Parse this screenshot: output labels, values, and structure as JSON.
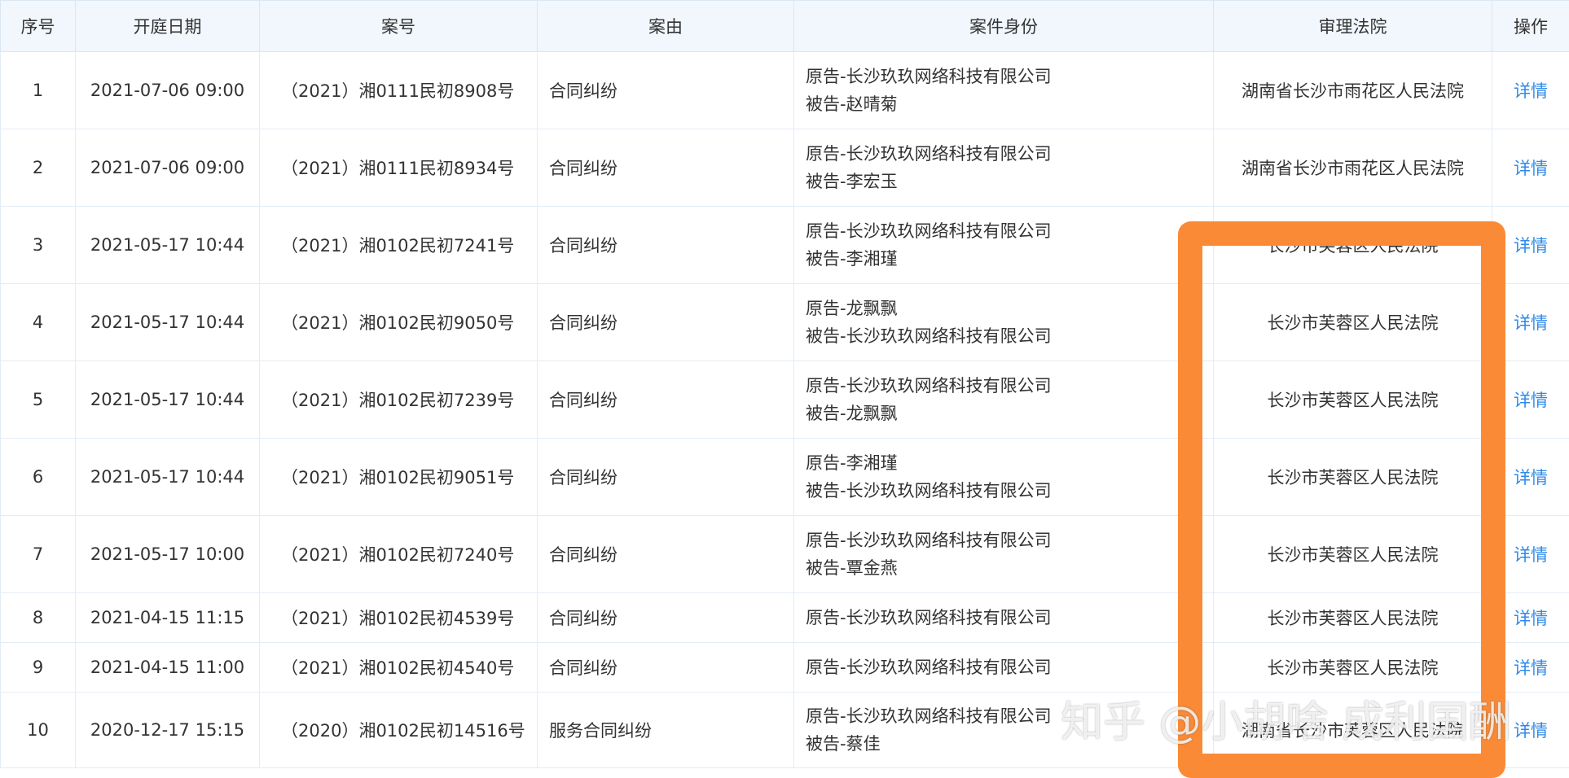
{
  "table": {
    "headers": {
      "no": "序号",
      "date": "开庭日期",
      "case_no": "案号",
      "reason": "案由",
      "identity": "案件身份",
      "court": "审理法院",
      "action": "操作"
    },
    "rows": [
      {
        "no": "1",
        "date": "2021-07-06 09:00",
        "case_no": "（2021）湘0111民初8908号",
        "reason": "合同纠纷",
        "party1": "原告-长沙玖玖网络科技有限公司",
        "party2": "被告-赵晴菊",
        "court": "湖南省长沙市雨花区人民法院",
        "action": "详情"
      },
      {
        "no": "2",
        "date": "2021-07-06 09:00",
        "case_no": "（2021）湘0111民初8934号",
        "reason": "合同纠纷",
        "party1": "原告-长沙玖玖网络科技有限公司",
        "party2": "被告-李宏玉",
        "court": "湖南省长沙市雨花区人民法院",
        "action": "详情"
      },
      {
        "no": "3",
        "date": "2021-05-17 10:44",
        "case_no": "（2021）湘0102民初7241号",
        "reason": "合同纠纷",
        "party1": "原告-长沙玖玖网络科技有限公司",
        "party2": "被告-李湘瑾",
        "court": "长沙市芙蓉区人民法院",
        "action": "详情"
      },
      {
        "no": "4",
        "date": "2021-05-17 10:44",
        "case_no": "（2021）湘0102民初9050号",
        "reason": "合同纠纷",
        "party1": "原告-龙飘飘",
        "party2": "被告-长沙玖玖网络科技有限公司",
        "court": "长沙市芙蓉区人民法院",
        "action": "详情"
      },
      {
        "no": "5",
        "date": "2021-05-17 10:44",
        "case_no": "（2021）湘0102民初7239号",
        "reason": "合同纠纷",
        "party1": "原告-长沙玖玖网络科技有限公司",
        "party2": "被告-龙飘飘",
        "court": "长沙市芙蓉区人民法院",
        "action": "详情"
      },
      {
        "no": "6",
        "date": "2021-05-17 10:44",
        "case_no": "（2021）湘0102民初9051号",
        "reason": "合同纠纷",
        "party1": "原告-李湘瑾",
        "party2": "被告-长沙玖玖网络科技有限公司",
        "court": "长沙市芙蓉区人民法院",
        "action": "详情"
      },
      {
        "no": "7",
        "date": "2021-05-17 10:00",
        "case_no": "（2021）湘0102民初7240号",
        "reason": "合同纠纷",
        "party1": "原告-长沙玖玖网络科技有限公司",
        "party2": "被告-覃金燕",
        "court": "长沙市芙蓉区人民法院",
        "action": "详情"
      },
      {
        "no": "8",
        "date": "2021-04-15 11:15",
        "case_no": "（2021）湘0102民初4539号",
        "reason": "合同纠纷",
        "party1": "原告-长沙玖玖网络科技有限公司",
        "party2": "",
        "court": "长沙市芙蓉区人民法院",
        "action": "详情"
      },
      {
        "no": "9",
        "date": "2021-04-15 11:00",
        "case_no": "（2021）湘0102民初4540号",
        "reason": "合同纠纷",
        "party1": "原告-长沙玖玖网络科技有限公司",
        "party2": "",
        "court": "长沙市芙蓉区人民法院",
        "action": "详情"
      },
      {
        "no": "10",
        "date": "2020-12-17 15:15",
        "case_no": "（2020）湘0102民初14516号",
        "reason": "服务合同纠纷",
        "party1": "原告-长沙玖玖网络科技有限公司",
        "party2": "被告-蔡佳",
        "court": "湖南省长沙市芙蓉区人民法院",
        "action": "详情"
      }
    ]
  },
  "watermark": "知乎 @小胡啥 成利国酬",
  "colors": {
    "header_bg": "#f2f7fd",
    "border": "#e3ecf5",
    "link": "#2f8ae8",
    "highlight": "#fb8a36"
  }
}
